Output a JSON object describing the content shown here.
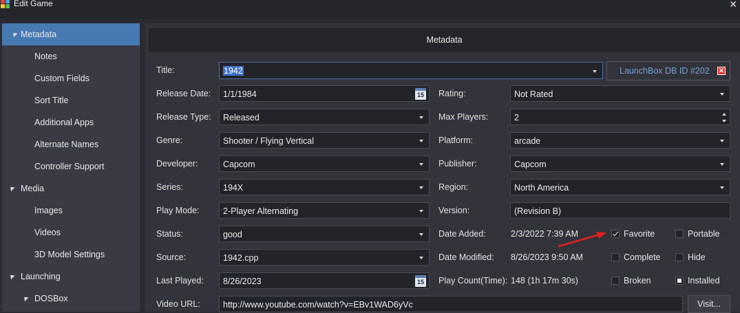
{
  "window": {
    "title": "Edit Game"
  },
  "sidebar": {
    "items": [
      {
        "label": "Metadata",
        "level": 0,
        "selected": true
      },
      {
        "label": "Notes",
        "level": 1
      },
      {
        "label": "Custom Fields",
        "level": 1
      },
      {
        "label": "Sort Title",
        "level": 1
      },
      {
        "label": "Additional Apps",
        "level": 1
      },
      {
        "label": "Alternate Names",
        "level": 1
      },
      {
        "label": "Controller Support",
        "level": 1
      },
      {
        "label": "Media",
        "level": 0
      },
      {
        "label": "Images",
        "level": 1
      },
      {
        "label": "Videos",
        "level": 1
      },
      {
        "label": "3D Model Settings",
        "level": 1
      },
      {
        "label": "Launching",
        "level": 0
      },
      {
        "label": "DOSBox",
        "level": 1
      }
    ]
  },
  "panel": {
    "header": "Metadata"
  },
  "form": {
    "title_label": "Title:",
    "title_value": "1942",
    "dbid_label": "LaunchBox DB ID #202",
    "release_date_label": "Release Date:",
    "release_date_value": "1/1/1984",
    "calendar_day": "15",
    "rating_label": "Rating:",
    "rating_value": "Not Rated",
    "release_type_label": "Release Type:",
    "release_type_value": "Released",
    "max_players_label": "Max Players:",
    "max_players_value": "2",
    "genre_label": "Genre:",
    "genre_value": "Shooter / Flying Vertical",
    "platform_label": "Platform:",
    "platform_value": "arcade",
    "developer_label": "Developer:",
    "developer_value": "Capcom",
    "publisher_label": "Publisher:",
    "publisher_value": "Capcom",
    "series_label": "Series:",
    "series_value": "194X",
    "region_label": "Region:",
    "region_value": "North America",
    "play_mode_label": "Play Mode:",
    "play_mode_value": "2-Player Alternating",
    "version_label": "Version:",
    "version_value": "(Revision B)",
    "status_label": "Status:",
    "status_value": "good",
    "date_added_label": "Date Added:",
    "date_added_value": "2/3/2022 7:39 AM",
    "source_label": "Source:",
    "source_value": "1942.cpp",
    "date_modified_label": "Date Modified:",
    "date_modified_value": "8/26/2023 9:50 AM",
    "last_played_label": "Last Played:",
    "last_played_value": "8/26/2023",
    "play_count_label": "Play Count(Time):",
    "play_count_value": "148 (1h 17m 30s)",
    "video_url_label": "Video URL:",
    "video_url_value": "http://www.youtube.com/watch?v=EBv1WAD6yVc",
    "visit_button": "Visit..."
  },
  "checkboxes": {
    "favorite": {
      "label": "Favorite",
      "checked": true
    },
    "portable": {
      "label": "Portable",
      "checked": false
    },
    "complete": {
      "label": "Complete",
      "checked": false
    },
    "hide": {
      "label": "Hide",
      "checked": false
    },
    "broken": {
      "label": "Broken",
      "checked": false
    },
    "installed": {
      "label": "Installed",
      "checked": "indeterminate"
    }
  },
  "colors": {
    "selection": "#4779b3",
    "annotation_arrow": "#e02020",
    "link": "#7aa1d2"
  }
}
